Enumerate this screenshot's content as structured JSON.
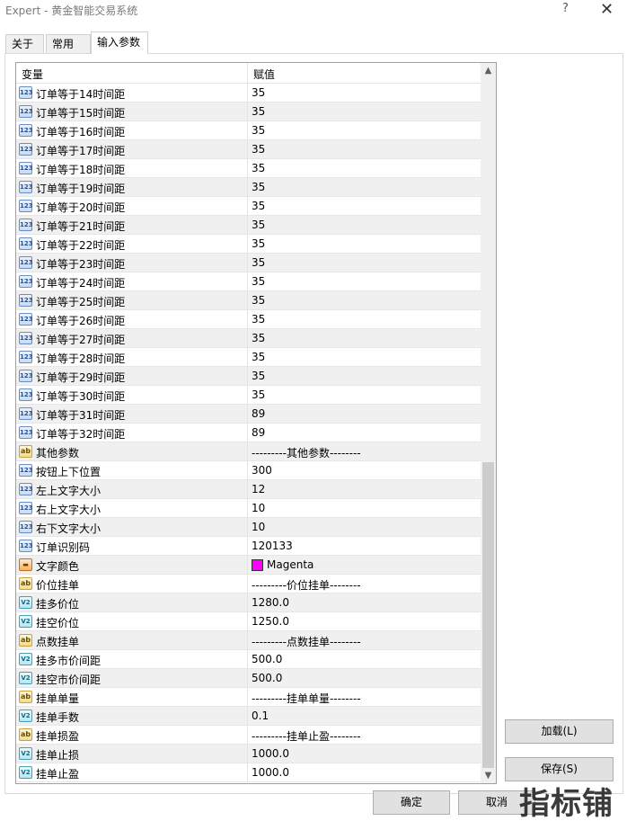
{
  "window": {
    "title": "Expert - 黄金智能交易系统",
    "help_label": "?",
    "close_label": "✕"
  },
  "tabs": [
    {
      "label": "关于"
    },
    {
      "label": "常用"
    },
    {
      "label": "输入参数"
    }
  ],
  "grid": {
    "col_variable": "变量",
    "col_value": "赋值",
    "rows": [
      {
        "icon": "int",
        "name": "订单等于14时间距",
        "value": "35"
      },
      {
        "icon": "int",
        "name": "订单等于15时间距",
        "value": "35"
      },
      {
        "icon": "int",
        "name": "订单等于16时间距",
        "value": "35"
      },
      {
        "icon": "int",
        "name": "订单等于17时间距",
        "value": "35"
      },
      {
        "icon": "int",
        "name": "订单等于18时间距",
        "value": "35"
      },
      {
        "icon": "int",
        "name": "订单等于19时间距",
        "value": "35"
      },
      {
        "icon": "int",
        "name": "订单等于20时间距",
        "value": "35"
      },
      {
        "icon": "int",
        "name": "订单等于21时间距",
        "value": "35"
      },
      {
        "icon": "int",
        "name": "订单等于22时间距",
        "value": "35"
      },
      {
        "icon": "int",
        "name": "订单等于23时间距",
        "value": "35"
      },
      {
        "icon": "int",
        "name": "订单等于24时间距",
        "value": "35"
      },
      {
        "icon": "int",
        "name": "订单等于25时间距",
        "value": "35"
      },
      {
        "icon": "int",
        "name": "订单等于26时间距",
        "value": "35"
      },
      {
        "icon": "int",
        "name": "订单等于27时间距",
        "value": "35"
      },
      {
        "icon": "int",
        "name": "订单等于28时间距",
        "value": "35"
      },
      {
        "icon": "int",
        "name": "订单等于29时间距",
        "value": "35"
      },
      {
        "icon": "int",
        "name": "订单等于30时间距",
        "value": "35"
      },
      {
        "icon": "int",
        "name": "订单等于31时间距",
        "value": "89"
      },
      {
        "icon": "int",
        "name": "订单等于32时间距",
        "value": "89"
      },
      {
        "icon": "string",
        "name": "其他参数",
        "value": "---------其他参数--------"
      },
      {
        "icon": "int",
        "name": "按钮上下位置",
        "value": "300"
      },
      {
        "icon": "int",
        "name": "左上文字大小",
        "value": "12"
      },
      {
        "icon": "int",
        "name": "右上文字大小",
        "value": "10"
      },
      {
        "icon": "int",
        "name": "右下文字大小",
        "value": "10"
      },
      {
        "icon": "int",
        "name": "订单识别码",
        "value": "120133"
      },
      {
        "icon": "color",
        "name": "文字颜色",
        "value": "Magenta",
        "swatch": "#ff00ff"
      },
      {
        "icon": "string",
        "name": "价位挂单",
        "value": "---------价位挂单--------"
      },
      {
        "icon": "double",
        "name": "挂多价位",
        "value": "1280.0"
      },
      {
        "icon": "double",
        "name": "挂空价位",
        "value": "1250.0"
      },
      {
        "icon": "string",
        "name": "点数挂单",
        "value": "---------点数挂单--------"
      },
      {
        "icon": "double",
        "name": "挂多市价间距",
        "value": "500.0"
      },
      {
        "icon": "double",
        "name": "挂空市价间距",
        "value": "500.0"
      },
      {
        "icon": "string",
        "name": "挂单单量",
        "value": "---------挂单单量--------"
      },
      {
        "icon": "double",
        "name": "挂单手数",
        "value": "0.1"
      },
      {
        "icon": "string",
        "name": "挂单损盈",
        "value": "---------挂单止盈--------"
      },
      {
        "icon": "double",
        "name": "挂单止损",
        "value": "1000.0"
      },
      {
        "icon": "double",
        "name": "挂单止盈",
        "value": "1000.0"
      }
    ]
  },
  "icon_glyphs": {
    "int": "123",
    "double": "V2",
    "string": "ab",
    "color": "▬"
  },
  "scroll": {
    "position_fraction": 0.55
  },
  "buttons": {
    "load": "加载(L)",
    "save": "保存(S)",
    "ok": "确定",
    "cancel": "取消"
  },
  "watermark": "指标铺"
}
